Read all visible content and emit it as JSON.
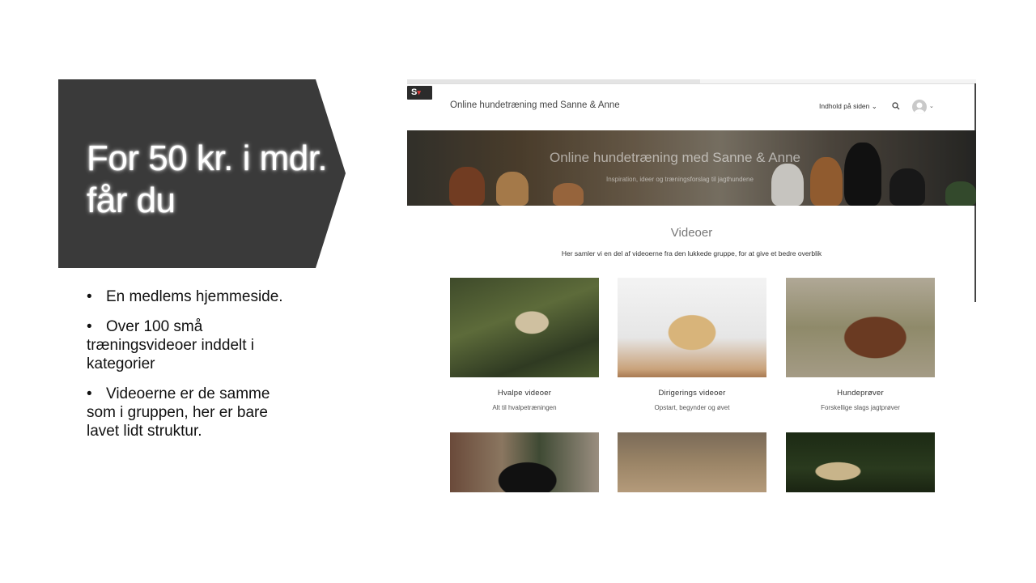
{
  "slide": {
    "title": "For 50 kr. i mdr. får du",
    "bullets": [
      "En medlems hjemmeside.",
      "Over 100 små træningsvideoer inddelt i kategorier",
      "Videoerne er de samme som i gruppen, her er bare lavet lidt struktur."
    ]
  },
  "site": {
    "logo": "S",
    "nav_title": "Online hundetræning med Sanne & Anne",
    "nav_menu": "Indhold på siden",
    "hero_title": "Online hundetræning med Sanne & Anne",
    "hero_subtitle": "Inspiration, ideer og træningsforslag til jagthundene",
    "section_title": "Videoer",
    "section_desc": "Her samler vi en del af videoerne fra den lukkede gruppe, for at give et bedre overblik",
    "cards": [
      {
        "title": "Hvalpe videoer",
        "subtitle": "Alt til hvalpetræningen"
      },
      {
        "title": "Dirigerings videoer",
        "subtitle": "Opstart, begynder og øvet"
      },
      {
        "title": "Hundeprøver",
        "subtitle": "Forskellige slags jagtprøver"
      }
    ]
  },
  "colors": {
    "banner": "#3a3a3a",
    "page_bg": "#ffffff"
  }
}
